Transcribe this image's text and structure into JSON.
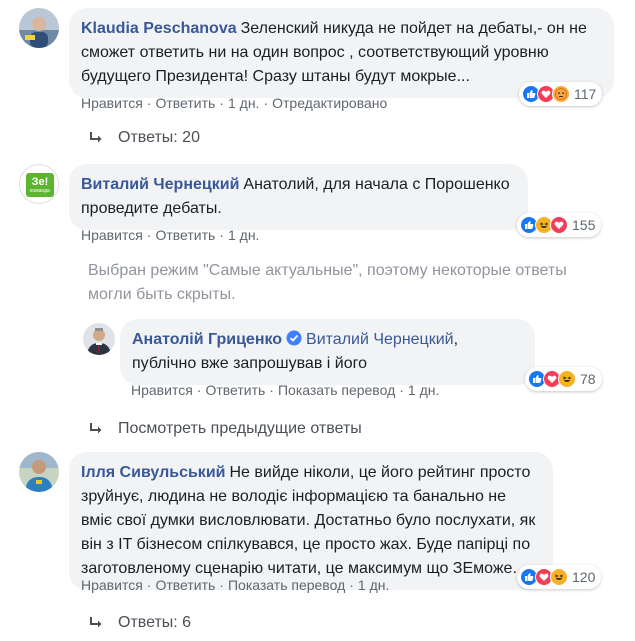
{
  "comments": [
    {
      "author": "Klaudia Peschanova",
      "text": "Зеленский никуда не пойдет на дебаты,- он не сможет ответить ни на один вопрос , соответствующий уровню будущего Президента! Сразу штаны будут мокрые...",
      "like": "Нравится",
      "reply": "Ответить",
      "time": "1 дн.",
      "edited": "Отредактировано",
      "reaction_count": "117",
      "replies_label": "Ответы: 20"
    },
    {
      "author": "Виталий Чернецкий",
      "text": "Анатолий, для начала с Порошенко проведите дебаты.",
      "like": "Нравится",
      "reply": "Ответить",
      "time": "1 дн.",
      "reaction_count": "155",
      "avatar_text": "Зе!",
      "avatar_subtext": "команда"
    },
    {
      "author": "Анатолій Гриценко",
      "mention": "Виталий Чернецкий",
      "text": ", публічно вже запрошував і його",
      "like": "Нравится",
      "reply": "Ответить",
      "translate": "Показать перевод",
      "time": "1 дн.",
      "reaction_count": "78"
    },
    {
      "author": "Ілля Сивульський",
      "text": "Не вийде ніколи, це його рейтинг просто зруйнує, людина не володіє інформацією та банально не вміє свої думки висловлювати. Достатньо було послухати, як він з IT бізнесом спілкувався, це просто жах. Буде папірці по заготовленому сценарію читати, це максимум що ЗЕможе.",
      "like": "Нравится",
      "reply": "Ответить",
      "translate": "Показать перевод",
      "time": "1 дн.",
      "reaction_count": "120",
      "replies_label": "Ответы: 6"
    }
  ],
  "notice": "Выбран режим \"Самые актуальные\", поэтому некоторые ответы могли быть скрыты.",
  "previous_replies": "Посмотреть предыдущие ответы",
  "colors": {
    "link": "#385898",
    "bubble": "#f2f3f5",
    "meta": "#606770",
    "like": "#1877f2",
    "love": "#f33e58",
    "haha": "#f7b125",
    "zeBrand": "#5cb531"
  },
  "icons": [
    "like-icon",
    "love-icon",
    "haha-icon",
    "angry-icon",
    "reply-arrow-icon",
    "verified-icon"
  ]
}
